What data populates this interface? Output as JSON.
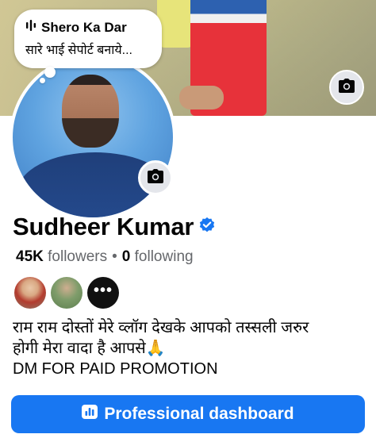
{
  "note": {
    "title": "Shero Ka Dar",
    "text": "सारे भाई सेपोर्ट बनाये..."
  },
  "profile": {
    "name": "Sudheer Kumar",
    "followers_count": "45K",
    "followers_label": "followers",
    "separator": "•",
    "following_count": "0",
    "following_label": "following",
    "more_friends_glyph": "•••"
  },
  "bio": {
    "line1": "राम राम दोस्तों मेरे व्लॉग देखके आपको तस्सली जरुर",
    "line2": "होगी मेरा वादा है आपसे🙏",
    "line3": "DM FOR PAID PROMOTION"
  },
  "actions": {
    "professional_dashboard": "Professional dashboard"
  },
  "icons": {
    "cover_camera": "camera-icon",
    "avatar_camera": "camera-icon",
    "verified": "verified-badge-icon",
    "dashboard": "dashboard-icon",
    "audio": "audio-wave-icon"
  },
  "colors": {
    "accent": "#1877f2",
    "secondary_text": "#65676b",
    "button_text": "#ffffff"
  }
}
